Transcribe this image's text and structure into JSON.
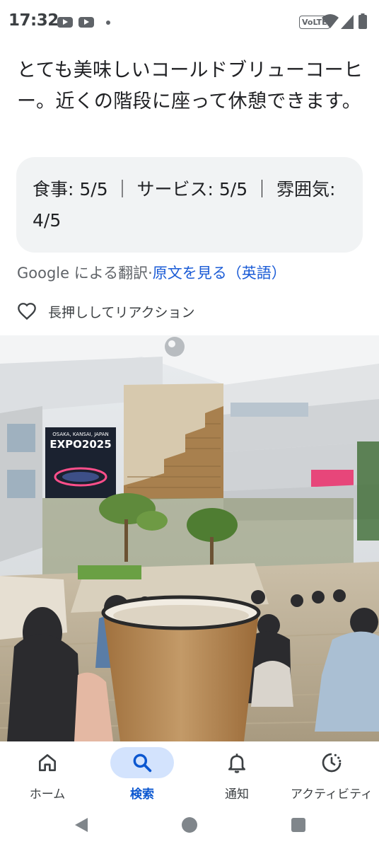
{
  "status_bar": {
    "time": "17:32",
    "notification_icons": [
      "youtube-icon",
      "youtube-icon",
      "dot-icon"
    ],
    "volte": "VoLTE",
    "system_icons": [
      "wifi-icon",
      "signal-icon",
      "battery-icon"
    ]
  },
  "review": {
    "text": "とても美味しいコールドブリューコーヒー。近くの階段に座って休憩できます。",
    "ratings": "食事: 5/5 ｜ サービス: 5/5 ｜ 雰囲気: 4/5",
    "translation_prefix": "Google による翻訳",
    "translation_sep": "·",
    "translation_link": "原文を見る（英語）",
    "reaction_label": "長押ししてリアクション",
    "photo_sign": "OSAKA, KANSAI, JAPAN",
    "photo_sign_title": "EXPO2025"
  },
  "bottom_nav": {
    "items": [
      {
        "label": "ホーム",
        "icon": "home-icon"
      },
      {
        "label": "検索",
        "icon": "search-icon"
      },
      {
        "label": "通知",
        "icon": "bell-icon"
      },
      {
        "label": "アクティビティ",
        "icon": "activity-icon"
      }
    ],
    "active_index": 1,
    "accent_color": "#0b57d0",
    "pill_color": "#d3e3fd"
  },
  "system_nav": [
    "back-icon",
    "home-circle-icon",
    "recents-icon"
  ]
}
